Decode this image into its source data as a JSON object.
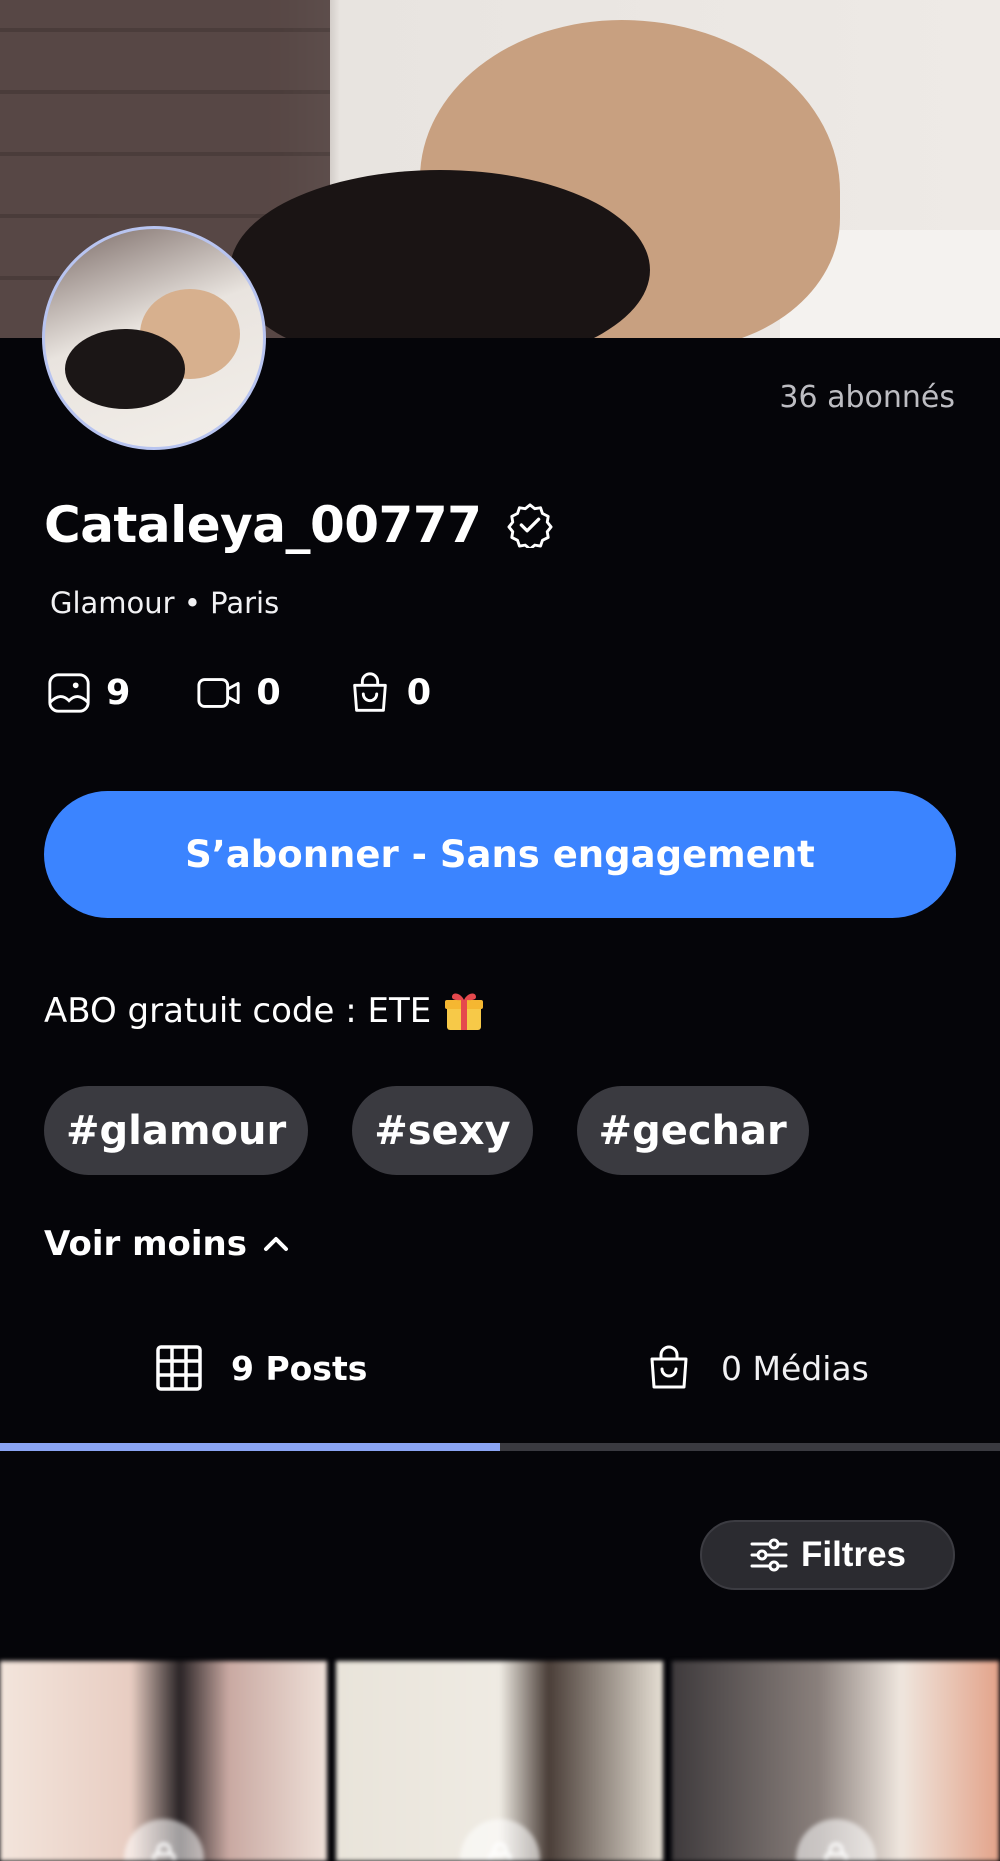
{
  "profile": {
    "username": "Cataleya_00777",
    "verified_icon": "verified-badge-icon",
    "followers_text": "36 abonnés",
    "meta_text": "Glamour • Paris"
  },
  "stats": {
    "photos": "9",
    "videos": "0",
    "shop": "0"
  },
  "subscribe_label": "S’abonner - Sans engagement",
  "promo_text": "ABO gratuit code : ETE",
  "tags": [
    "#glamour",
    "#sexy",
    "#gechar"
  ],
  "see_less_label": "Voir moins",
  "tabs": {
    "posts_label": "9 Posts",
    "media_label": "0 Médias",
    "active_fraction": 0.5
  },
  "filters_label": "Filtres",
  "colors": {
    "accent": "#3b84ff",
    "background": "#050509",
    "tag_bg": "#3a3a40",
    "tab_indicator": "#8aa4f2"
  }
}
